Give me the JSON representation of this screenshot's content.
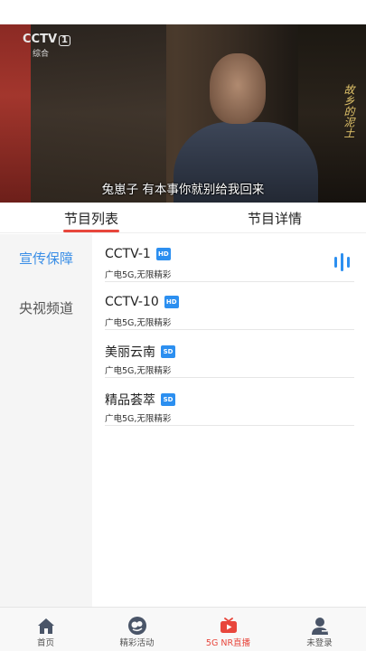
{
  "video": {
    "channel_logo": "CCTV",
    "channel_number": "1",
    "channel_sub": "综合",
    "show_title": "故乡的泥土",
    "subtitle": "兔崽子  有本事你就别给我回来"
  },
  "tabs": [
    {
      "label": "节目列表",
      "active": true
    },
    {
      "label": "节目详情",
      "active": false
    }
  ],
  "sidebar": {
    "items": [
      {
        "label": "宣传保障",
        "active": true
      },
      {
        "label": "央视频道",
        "active": false
      }
    ]
  },
  "channels": [
    {
      "name": "CCTV-1",
      "badge": "HD",
      "desc": "广电5G,无限精彩",
      "playing": true
    },
    {
      "name": "CCTV-10",
      "badge": "HD",
      "desc": "广电5G,无限精彩",
      "playing": false
    },
    {
      "name": "美丽云南",
      "badge": "SD",
      "desc": "广电5G,无限精彩",
      "playing": false
    },
    {
      "name": "精品荟萃",
      "badge": "SD",
      "desc": "广电5G,无限精彩",
      "playing": false
    }
  ],
  "bottom_nav": [
    {
      "label": "首页",
      "icon": "home-icon",
      "active": false
    },
    {
      "label": "精彩活动",
      "icon": "activity-icon",
      "active": false
    },
    {
      "label": "5G NR直播",
      "icon": "tv-icon",
      "active": true
    },
    {
      "label": "未登录",
      "icon": "user-icon",
      "active": false
    }
  ],
  "colors": {
    "accent_red": "#e8463c",
    "accent_blue": "#3a8ee6",
    "badge_blue": "#2c8ff0"
  }
}
